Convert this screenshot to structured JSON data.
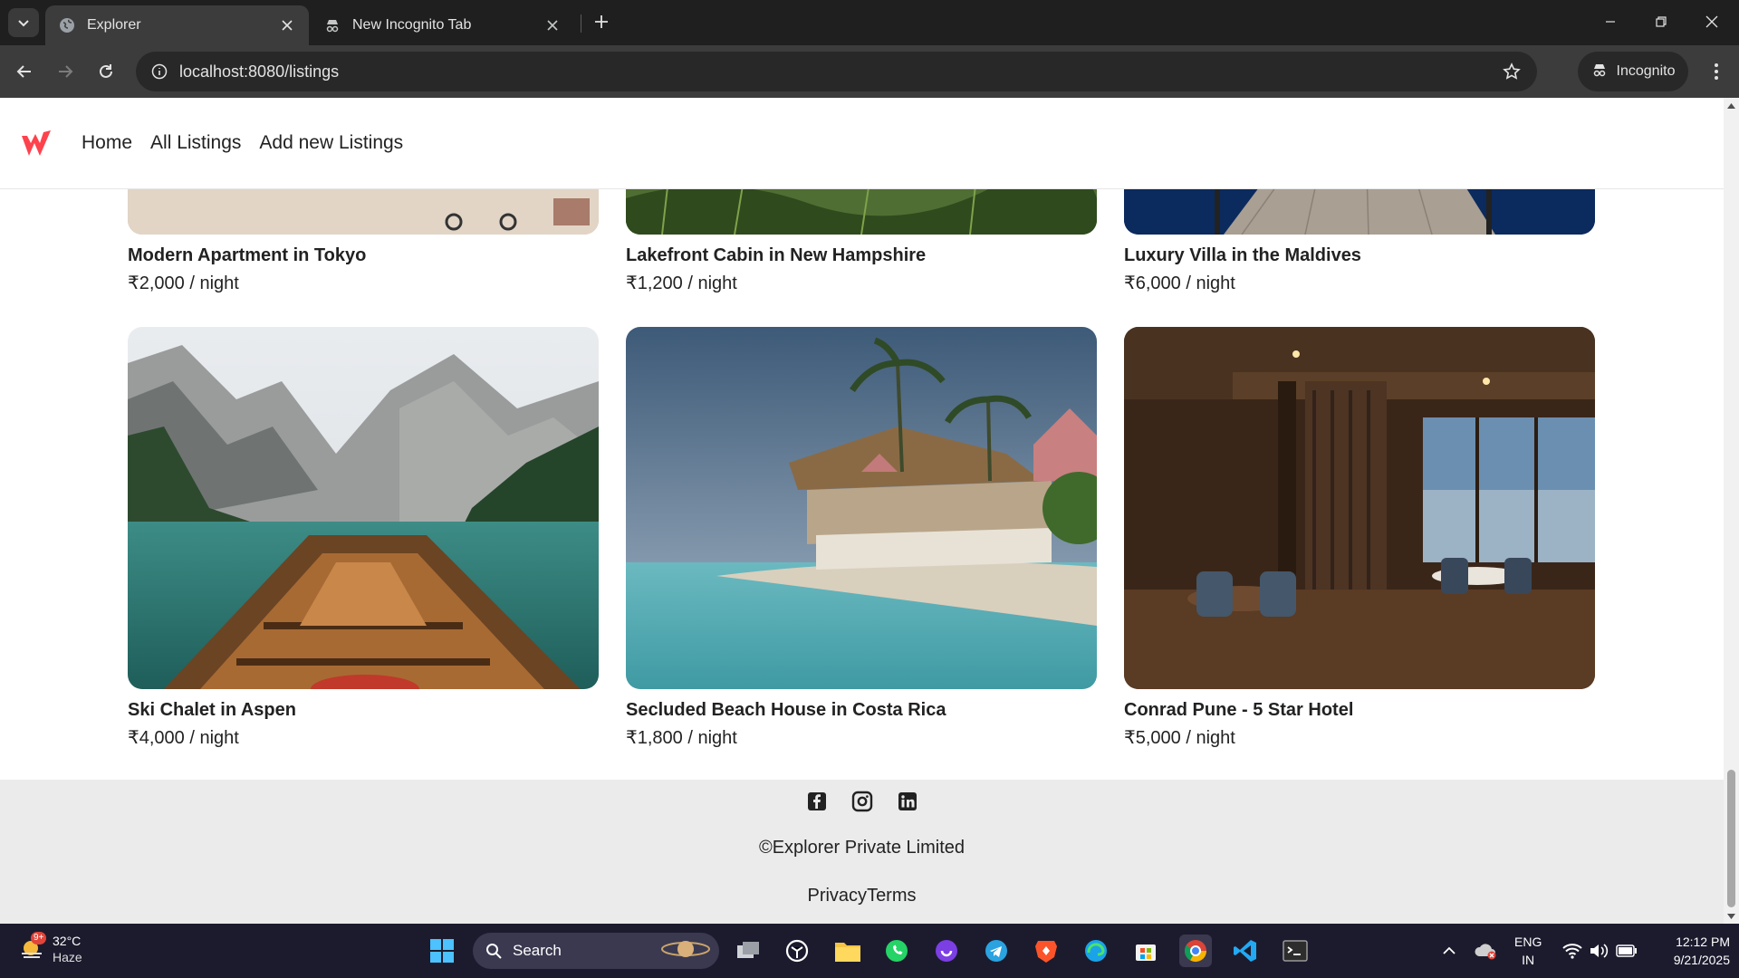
{
  "browser": {
    "tabs": [
      {
        "title": "Explorer",
        "active": true
      },
      {
        "title": "New Incognito Tab",
        "active": false
      }
    ],
    "url": "localhost:8080/listings",
    "profile_label": "Incognito"
  },
  "site": {
    "nav": {
      "home": "Home",
      "all_listings": "All Listings",
      "add_listing": "Add new Listings"
    },
    "brand_color": "#fe424d",
    "listings": [
      {
        "title": "Modern Apartment in Tokyo",
        "price": "₹2,000 / night"
      },
      {
        "title": "Lakefront Cabin in New Hampshire",
        "price": "₹1,200 / night"
      },
      {
        "title": "Luxury Villa in the Maldives",
        "price": "₹6,000 / night"
      },
      {
        "title": "Ski Chalet in Aspen",
        "price": "₹4,000 / night"
      },
      {
        "title": "Secluded Beach House in Costa Rica",
        "price": "₹1,800 / night"
      },
      {
        "title": "Conrad Pune - 5 Star Hotel",
        "price": "₹5,000 / night"
      }
    ],
    "footer": {
      "socials": [
        "facebook-icon",
        "instagram-icon",
        "linkedin-icon"
      ],
      "copyright": "©Explorer Private Limited",
      "privacy": "Privacy",
      "terms": "Terms"
    }
  },
  "taskbar": {
    "weather_temp": "32°C",
    "weather_cond": "Haze",
    "weather_badge": "9+",
    "search_label": "Search",
    "lang_top": "ENG",
    "lang_bottom": "IN",
    "time": "12:12 PM",
    "date": "9/21/2025"
  }
}
